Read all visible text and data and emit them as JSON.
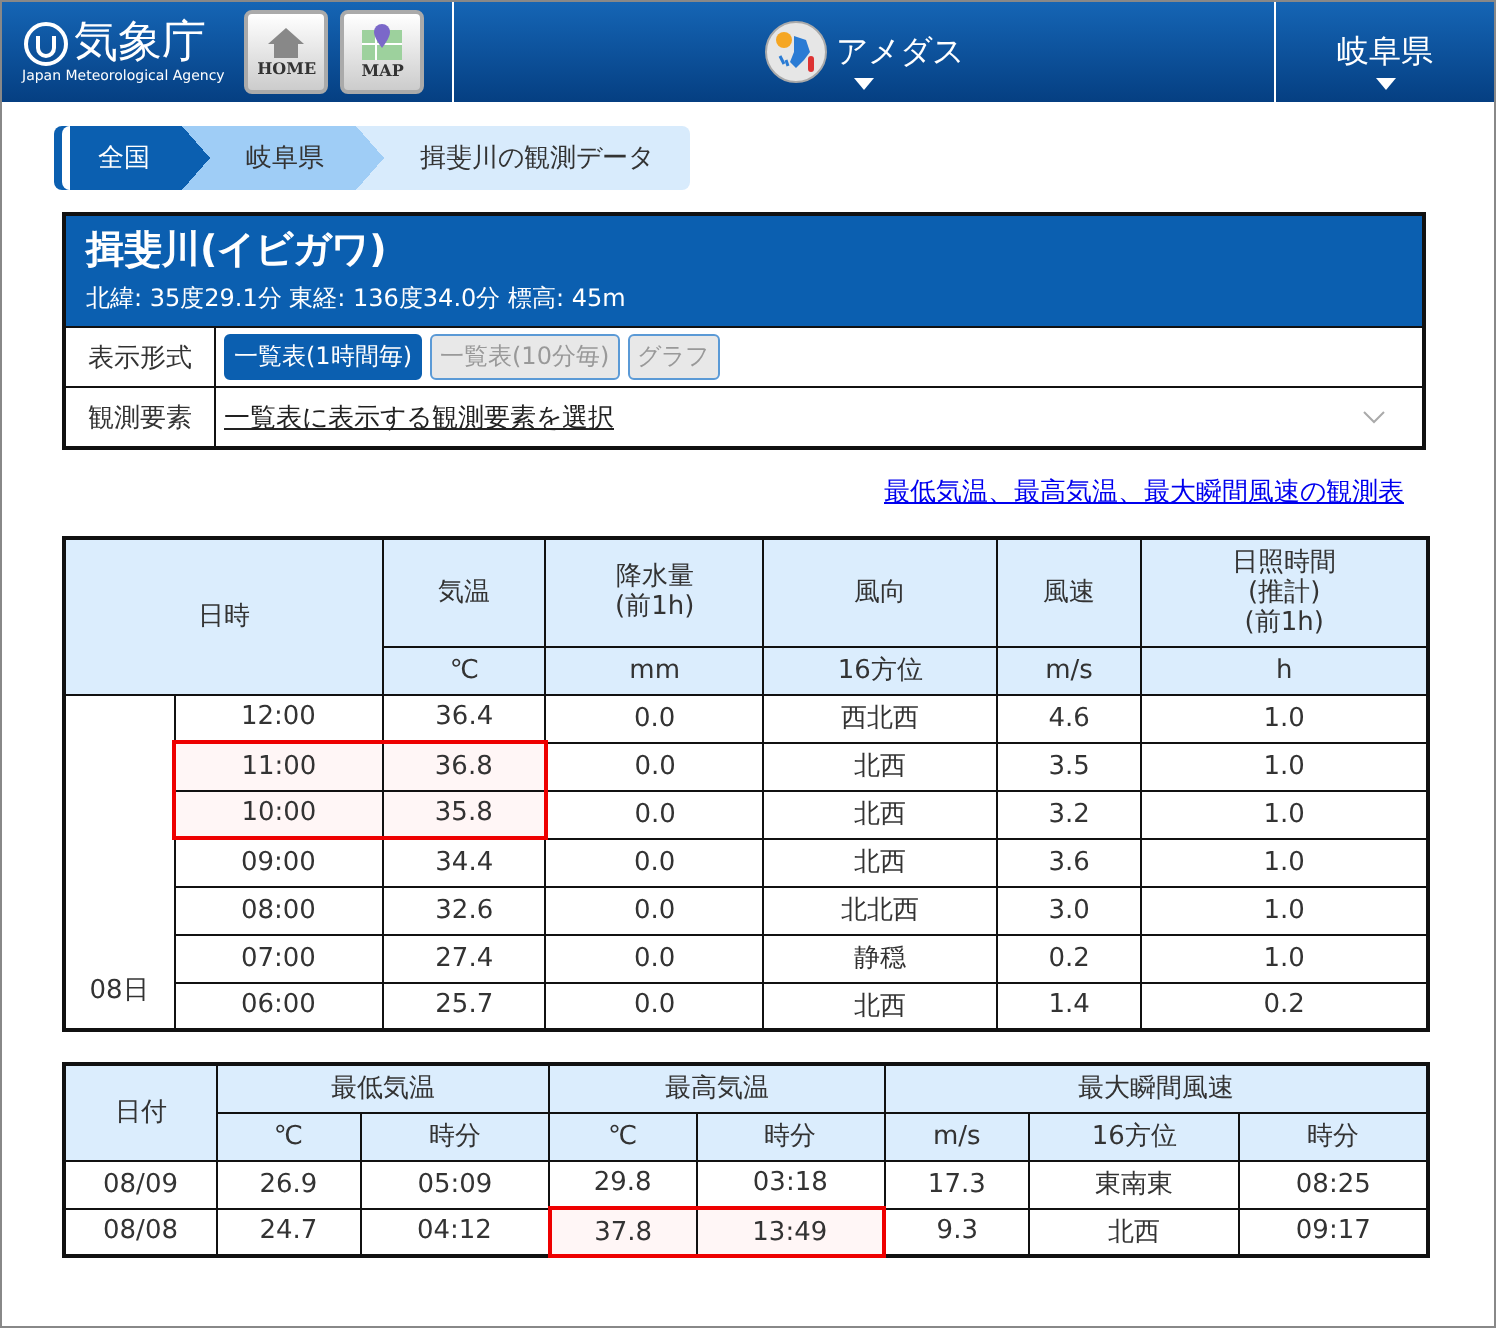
{
  "header": {
    "logo_title": "気象庁",
    "logo_subtitle": "Japan Meteorological Agency",
    "home_label": "HOME",
    "map_label": "MAP",
    "menus": [
      {
        "label": "アメダス",
        "kind": "amedas"
      },
      {
        "label": "岐阜県",
        "kind": "plain"
      }
    ]
  },
  "breadcrumb": [
    {
      "label": "全国",
      "kind": "root"
    },
    {
      "label": "岐阜県",
      "kind": "mid"
    },
    {
      "label": "揖斐川の観測データ",
      "kind": "current"
    }
  ],
  "station": {
    "name": "揖斐川(イビガワ)",
    "position": "北緯: 35度29.1分 東経: 136度34.0分 標高: 45m",
    "format_label": "表示形式",
    "formats": [
      {
        "label": "一覧表(1時間毎)",
        "selected": true
      },
      {
        "label": "一覧表(10分毎)",
        "selected": false
      },
      {
        "label": "グラフ",
        "selected": false
      }
    ],
    "elements_label": "観測要素",
    "elements_link": "一覧表に表示する観測要素を選択"
  },
  "summary_link": "最低気温、最高気温、最大瞬間風速の観測表",
  "table": {
    "datetime_header": "日時",
    "columns": [
      {
        "title": "気温",
        "unit": "℃"
      },
      {
        "title": "降水量\n(前1h)",
        "unit": "mm"
      },
      {
        "title": "風向",
        "unit": "16方位"
      },
      {
        "title": "風速",
        "unit": "m/s"
      },
      {
        "title": "日照時間\n(推計)\n(前1h)",
        "unit": "h"
      }
    ],
    "date": "08日",
    "rows": [
      {
        "time": "12:00",
        "values": [
          "36.4",
          "0.0",
          "西北西",
          "4.6",
          "1.0"
        ],
        "highlighted": false
      },
      {
        "time": "11:00",
        "values": [
          "36.8",
          "0.0",
          "北西",
          "3.5",
          "1.0"
        ],
        "highlighted": true
      },
      {
        "time": "10:00",
        "values": [
          "35.8",
          "0.0",
          "北西",
          "3.2",
          "1.0"
        ],
        "highlighted": true
      },
      {
        "time": "09:00",
        "values": [
          "34.4",
          "0.0",
          "北西",
          "3.6",
          "1.0"
        ],
        "highlighted": false
      },
      {
        "time": "08:00",
        "values": [
          "32.6",
          "0.0",
          "北北西",
          "3.0",
          "1.0"
        ],
        "highlighted": false
      },
      {
        "time": "07:00",
        "values": [
          "27.4",
          "0.0",
          "静穏",
          "0.2",
          "1.0"
        ],
        "highlighted": false
      },
      {
        "time": "06:00",
        "values": [
          "25.7",
          "0.0",
          "北西",
          "1.4",
          "0.2"
        ],
        "highlighted": false
      }
    ]
  },
  "summary": {
    "date_header": "日付",
    "groups": [
      {
        "title": "最低気温",
        "units": [
          "℃",
          "時分"
        ]
      },
      {
        "title": "最高気温",
        "units": [
          "℃",
          "時分"
        ]
      },
      {
        "title": "最大瞬間風速",
        "units": [
          "m/s",
          "16方位",
          "時分"
        ]
      }
    ],
    "rows": [
      {
        "date": "08/09",
        "groups": [
          [
            "26.9",
            "05:09"
          ],
          [
            "29.8",
            "03:18"
          ],
          [
            "17.3",
            "東南東",
            "08:25"
          ]
        ],
        "highlighted_group": false
      },
      {
        "date": "08/08",
        "groups": [
          [
            "24.7",
            "04:12"
          ],
          [
            "37.8",
            "13:49"
          ],
          [
            "9.3",
            "北西",
            "09:17"
          ]
        ],
        "highlighted_group": true
      }
    ]
  }
}
